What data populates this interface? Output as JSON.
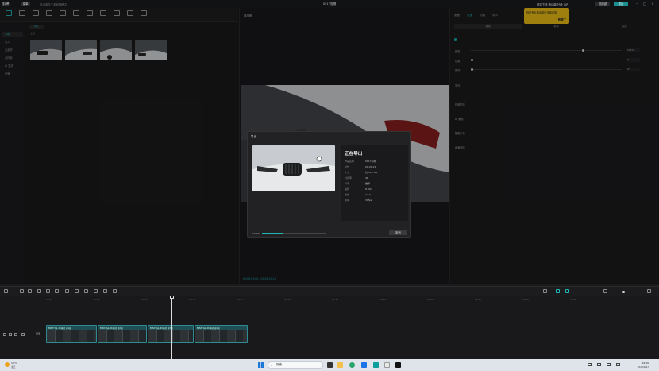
{
  "app": {
    "name": "剪映",
    "menu": "菜单",
    "autosave": "自动保存于本地草稿中",
    "project_title": "0917剪辑",
    "top_right_notice": "即将下线 移动端 升级 VIP",
    "shortcut_label": "快捷键",
    "export_label": "导出"
  },
  "toolbar": {
    "items": [
      {
        "label": "媒体",
        "icon": "media-icon"
      },
      {
        "label": "音频",
        "icon": "audio-icon"
      },
      {
        "label": "文本",
        "icon": "text-icon"
      },
      {
        "label": "贴纸",
        "icon": "sticker-icon"
      },
      {
        "label": "特效",
        "icon": "effects-icon"
      },
      {
        "label": "转场",
        "icon": "transition-icon"
      },
      {
        "label": "AI 字幕",
        "icon": "caption-icon"
      },
      {
        "label": "滤镜",
        "icon": "filter-icon"
      },
      {
        "label": "调节",
        "icon": "adjust-icon"
      },
      {
        "label": "模板",
        "icon": "template-icon"
      },
      {
        "label": "AI 效果",
        "icon": "ai-icon"
      }
    ]
  },
  "leftnav": {
    "items": [
      "本地",
      "导入",
      "云素材",
      "素材库",
      "AI 生成",
      "品牌",
      "我的"
    ]
  },
  "media": {
    "import_label": "导入",
    "all_label": "全部",
    "thumbs": [
      "BMW_01.mp4",
      "BMW_02.mp4",
      "BMW_03.mp4",
      "BMW_04.mp4"
    ]
  },
  "player": {
    "title": "播放器",
    "time": "00:00:01:05 / 00:00:21:10"
  },
  "inspector": {
    "tabs": [
      "画面",
      "变速",
      "动画",
      "调节"
    ],
    "subtabs": [
      "基础",
      "抠像",
      "蒙版"
    ],
    "rows": [
      {
        "label": "缩放",
        "value": "100%"
      },
      {
        "label": "位置",
        "value": "0"
      },
      {
        "label": "旋转",
        "value": "0°"
      },
      {
        "label": "混合",
        "value": ""
      },
      {
        "label": "视频防抖",
        "value": ""
      },
      {
        "label": "AI 美颜",
        "value": ""
      },
      {
        "label": "智能补帧",
        "value": ""
      },
      {
        "label": "画面增强",
        "value": ""
      }
    ]
  },
  "tooltip": {
    "line1": "你的专业版功能已全部可用",
    "action": "知道了"
  },
  "dialog": {
    "title": "导出",
    "heading": "正在导出",
    "info": [
      {
        "k": "作品名称",
        "v": "0917剪辑"
      },
      {
        "k": "时长",
        "v": "00:00:21"
      },
      {
        "k": "大小",
        "v": "约 120 MB"
      },
      {
        "k": "分辨率",
        "v": "4K"
      },
      {
        "k": "码率",
        "v": "推荐"
      },
      {
        "k": "编码",
        "v": "H.264"
      },
      {
        "k": "格式",
        "v": "mp4"
      },
      {
        "k": "帧率",
        "v": "30fps"
      }
    ],
    "progress_label": "15.3%",
    "progress": 0.33,
    "cancel": "取消"
  },
  "timeline": {
    "ticks": [
      "00:00",
      "00:05",
      "00:10",
      "00:15",
      "00:20",
      "00:25",
      "00:30",
      "00:35",
      "00:40",
      "00:45",
      "00:50",
      "00:55"
    ],
    "track_label": "封面",
    "clips": [
      "BMW 5系 4K素材 第1段",
      "BMW 5系 4K素材 第2段",
      "BMW 5系 4K素材 第3段",
      "BMW 5系 4K素材 第4段"
    ]
  },
  "taskbar": {
    "weather": "18°C",
    "weather_sub": "多云",
    "search": "搜索",
    "time": "19:30",
    "date": "2023/9/17"
  },
  "colors": {
    "accent": "#1fb6b6",
    "tooltip": "#f5c518",
    "clip": "#1f4e55"
  }
}
